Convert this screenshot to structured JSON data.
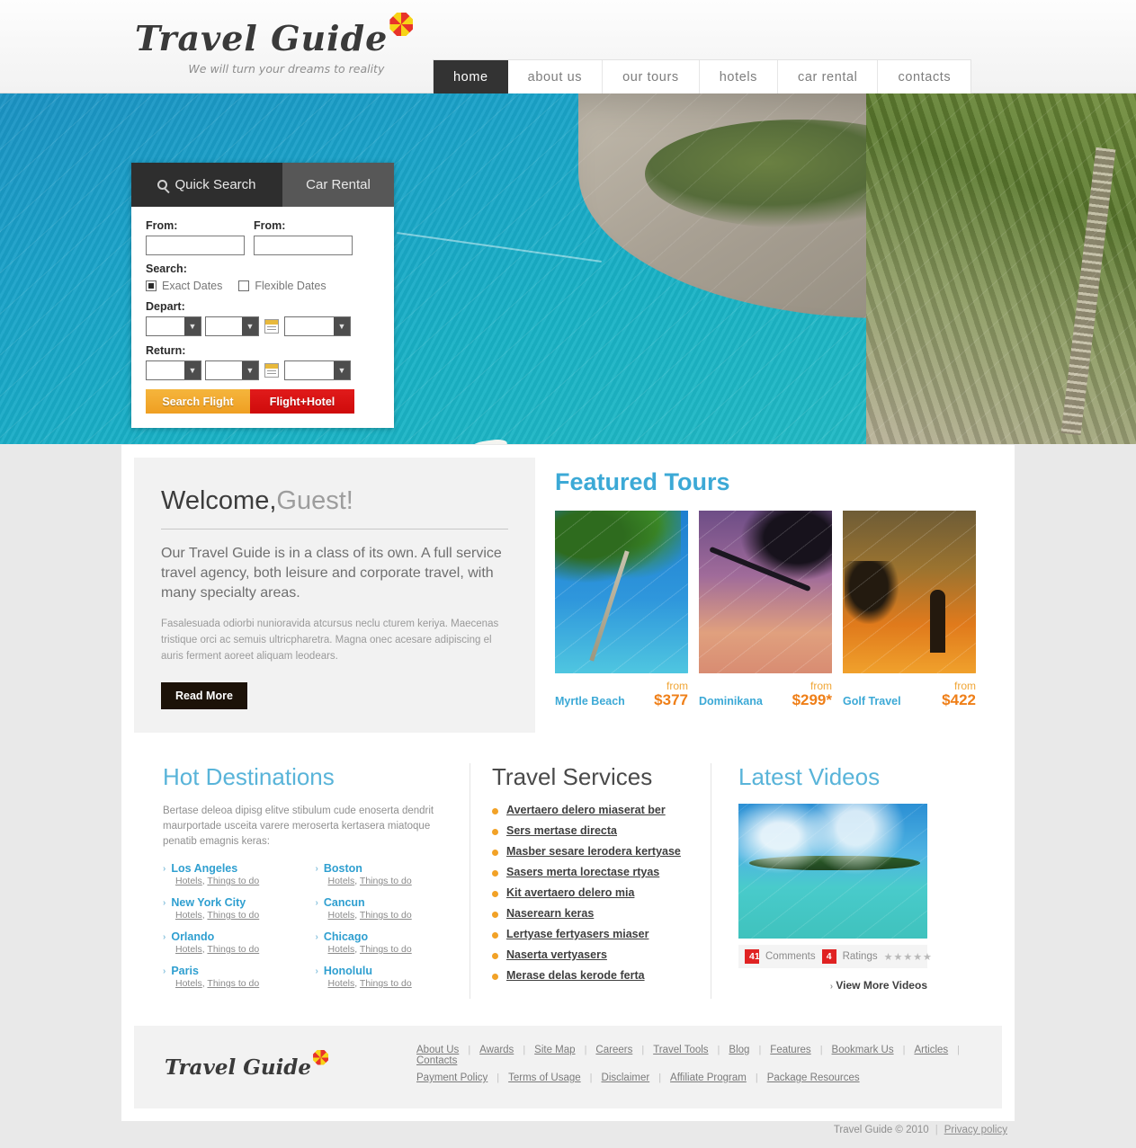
{
  "header": {
    "logo": "Travel Guide",
    "tagline": "We will turn your dreams to reality",
    "nav": [
      {
        "label": "home",
        "active": true
      },
      {
        "label": "about us",
        "active": false
      },
      {
        "label": "our tours",
        "active": false
      },
      {
        "label": "hotels",
        "active": false
      },
      {
        "label": "car rental",
        "active": false
      },
      {
        "label": "contacts",
        "active": false
      }
    ]
  },
  "search_panel": {
    "tab_quick": "Quick Search",
    "tab_car": "Car Rental",
    "from_label_1": "From:",
    "from_label_2": "From:",
    "from_value_1": "",
    "from_value_2": "",
    "search_label": "Search:",
    "exact_dates": "Exact Dates",
    "flexible_dates": "Flexible Dates",
    "exact_checked": true,
    "flexible_checked": false,
    "depart_label": "Depart:",
    "return_label": "Return:",
    "btn_search_flight": "Search Flight",
    "btn_flight_hotel": "Flight+Hotel"
  },
  "welcome": {
    "title_main": "Welcome,",
    "title_guest": "Guest!",
    "lead": "Our Travel Guide is in a class of its own. A full service travel agency, both leisure and corporate travel, with many specialty areas.",
    "sub": "Fasalesuada odiorbi nunioravida atcursus neclu cturem keriya. Maecenas tristique orci ac semuis ultricpharetra. Magna onec acesare adipiscing el auris ferment aoreet aliquam leodears.",
    "read_more": "Read More"
  },
  "featured": {
    "title": "Featured Tours",
    "from_label": "from",
    "tours": [
      {
        "name": "Myrtle Beach",
        "price": "$377"
      },
      {
        "name": "Dominikana",
        "price": "$299*"
      },
      {
        "name": "Golf Travel",
        "price": "$422"
      }
    ]
  },
  "destinations": {
    "title": "Hot Destinations",
    "description": "Bertase deleoa dipisg elitve stibulum cude enoserta dendrit maurportade usceita varere meroserta kertasera miatoque penatib emagnis keras:",
    "hotels_link": "Hotels",
    "things_link": "Things to do",
    "left": [
      "Los Angeles",
      "New York City",
      "Orlando",
      "Paris"
    ],
    "right": [
      "Boston",
      "Cancun",
      "Chicago",
      "Honolulu"
    ]
  },
  "services": {
    "title": "Travel Services",
    "items": [
      "Avertaero delero miaserat ber",
      "Sers mertase directa",
      "Masber sesare lerodera kertyase",
      "Sasers merta lorectase rtyas",
      "Kit avertaero delero mia",
      "Naserearn keras",
      "Lertyase fertyasers miaser",
      "Naserta vertyasers",
      "Merase delas kerode ferta"
    ]
  },
  "videos": {
    "title": "Latest Videos",
    "comments_count": "41",
    "comments_label": "Comments",
    "ratings_count": "4",
    "ratings_label": "Ratings",
    "stars": "★★★★★",
    "view_more": "View More Videos"
  },
  "footer": {
    "logo": "Travel Guide",
    "row1": [
      "About Us",
      "Awards",
      "Site Map",
      "Careers",
      "Travel Tools",
      "Blog",
      "Features",
      "Bookmark Us",
      "Articles",
      "Contacts"
    ],
    "row2": [
      "Payment Policy",
      "Terms of Usage",
      "Disclaimer",
      "Affiliate Program",
      "Package Resources"
    ],
    "copyright": "Travel Guide © 2010",
    "privacy": "Privacy policy"
  },
  "colors": {
    "accent_blue": "#3ca9d6",
    "accent_orange": "#ef7f18",
    "badge_red": "#e02222",
    "nav_active": "#333333"
  }
}
